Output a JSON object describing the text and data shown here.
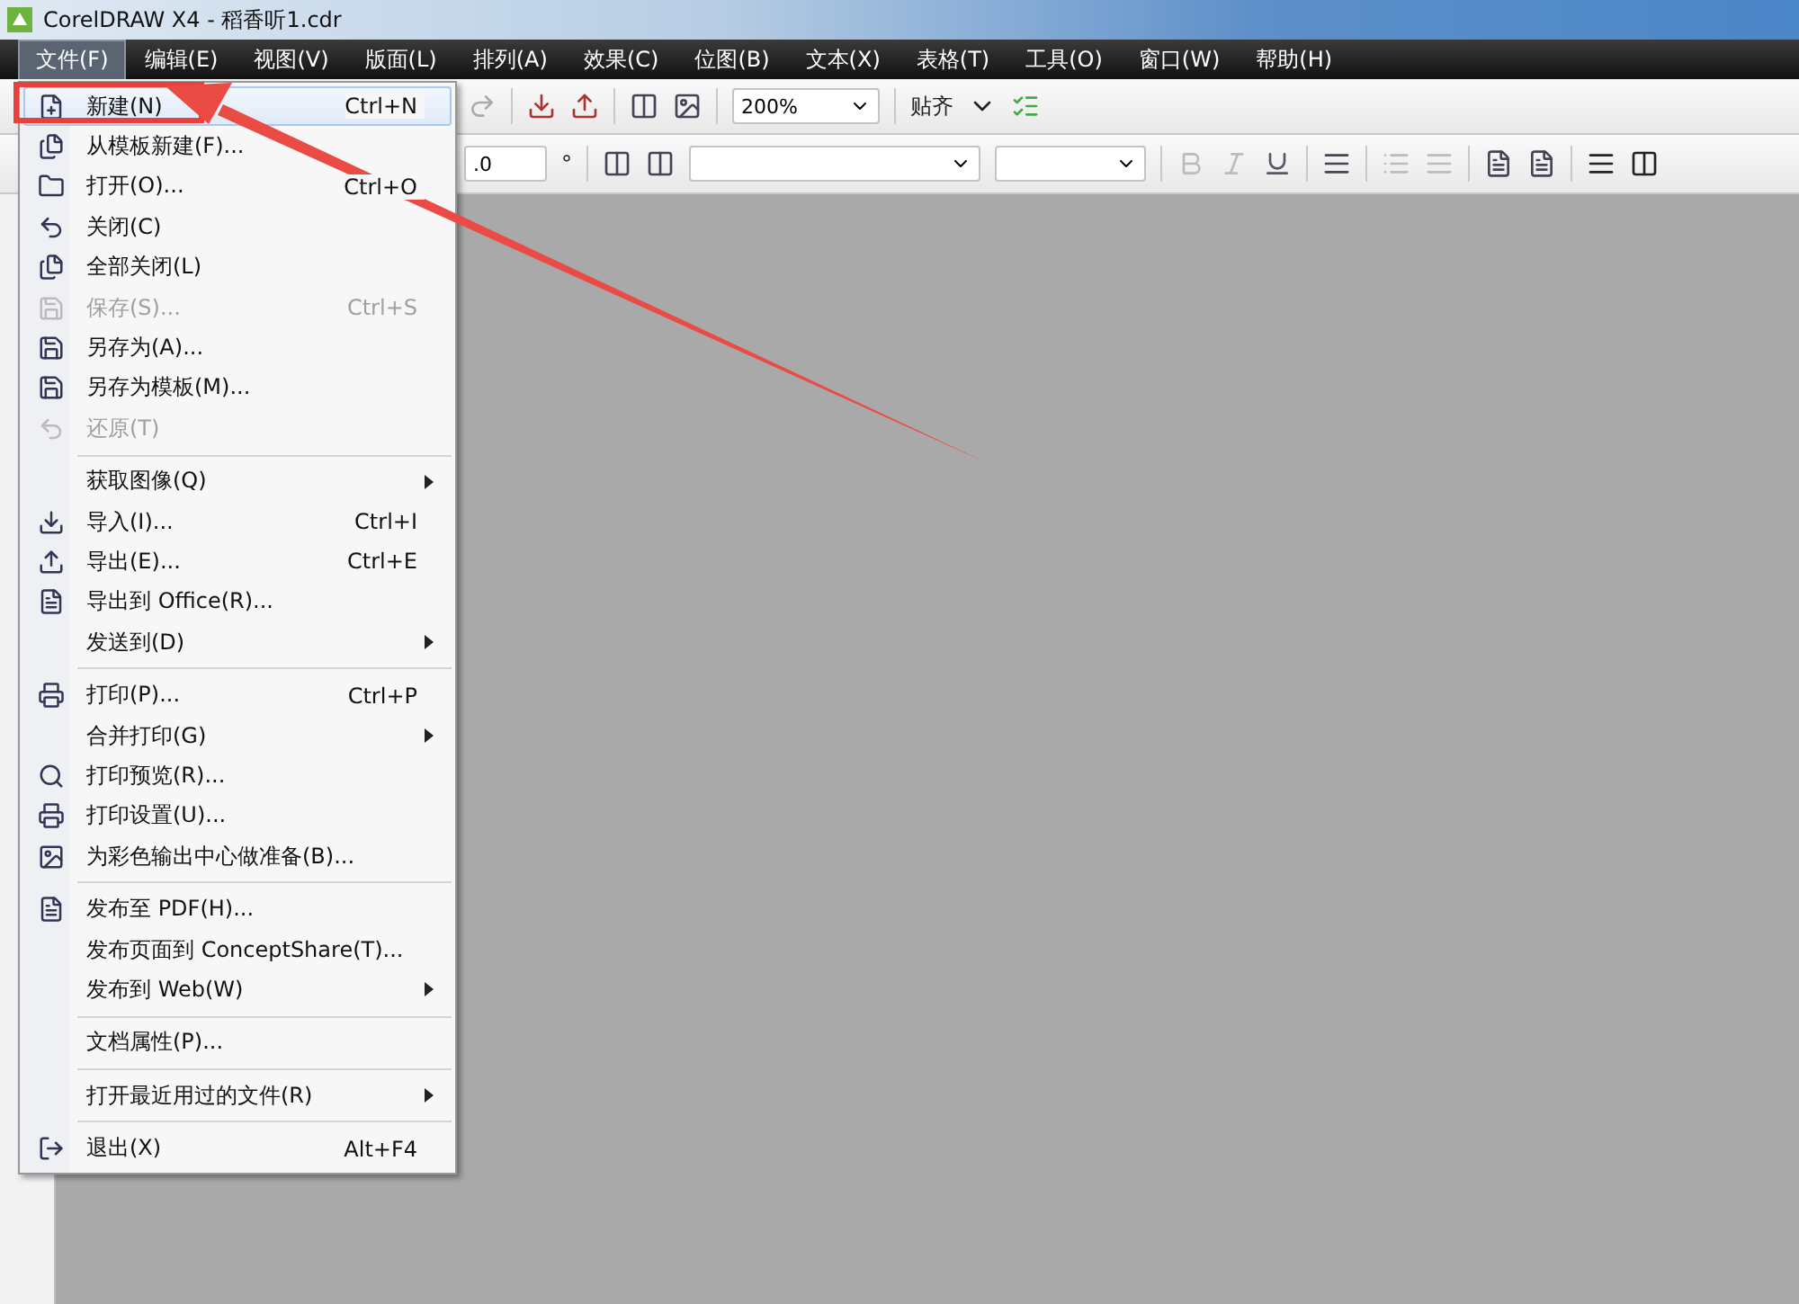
{
  "window": {
    "title": "CorelDRAW X4 - 稻香听1.cdr"
  },
  "menu_bar": [
    {
      "label": "文件(F)",
      "selected": true
    },
    {
      "label": "编辑(E)",
      "selected": false
    },
    {
      "label": "视图(V)",
      "selected": false
    },
    {
      "label": "版面(L)",
      "selected": false
    },
    {
      "label": "排列(A)",
      "selected": false
    },
    {
      "label": "效果(C)",
      "selected": false
    },
    {
      "label": "位图(B)",
      "selected": false
    },
    {
      "label": "文本(X)",
      "selected": false
    },
    {
      "label": "表格(T)",
      "selected": false
    },
    {
      "label": "工具(O)",
      "selected": false
    },
    {
      "label": "窗口(W)",
      "selected": false
    },
    {
      "label": "帮助(H)",
      "selected": false
    }
  ],
  "toolbar": {
    "zoom": "200%",
    "snap": "贴齐"
  },
  "property_bar": {
    "angle_value": ".0",
    "degree_sign": "°"
  },
  "file_menu": {
    "groups": [
      [
        {
          "label": "新建(N)",
          "shortcut": "Ctrl+N",
          "disabled": false,
          "submenu": false,
          "selected": true
        },
        {
          "label": "从模板新建(F)...",
          "disabled": false,
          "submenu": false,
          "selected": false
        },
        {
          "label": "打开(O)...",
          "shortcut": "Ctrl+O",
          "disabled": false,
          "submenu": false,
          "selected": false
        },
        {
          "label": "关闭(C)",
          "disabled": false,
          "submenu": false,
          "selected": false
        },
        {
          "label": "全部关闭(L)",
          "disabled": false,
          "submenu": false,
          "selected": false
        },
        {
          "label": "保存(S)...",
          "shortcut": "Ctrl+S",
          "disabled": true,
          "submenu": false,
          "selected": false
        },
        {
          "label": "另存为(A)...",
          "disabled": false,
          "submenu": false,
          "selected": false
        },
        {
          "label": "另存为模板(M)...",
          "disabled": false,
          "submenu": false,
          "selected": false
        },
        {
          "label": "还原(T)",
          "disabled": true,
          "submenu": false,
          "selected": false
        }
      ],
      [
        {
          "label": "获取图像(Q)",
          "disabled": false,
          "submenu": true,
          "selected": false
        },
        {
          "label": "导入(I)...",
          "shortcut": "Ctrl+I",
          "disabled": false,
          "submenu": false,
          "selected": false
        },
        {
          "label": "导出(E)...",
          "shortcut": "Ctrl+E",
          "disabled": false,
          "submenu": false,
          "selected": false
        },
        {
          "label": "导出到 Office(R)...",
          "disabled": false,
          "submenu": false,
          "selected": false
        },
        {
          "label": "发送到(D)",
          "disabled": false,
          "submenu": true,
          "selected": false
        }
      ],
      [
        {
          "label": "打印(P)...",
          "shortcut": "Ctrl+P",
          "disabled": false,
          "submenu": false,
          "selected": false
        },
        {
          "label": "合并打印(G)",
          "disabled": false,
          "submenu": true,
          "selected": false
        },
        {
          "label": "打印预览(R)...",
          "disabled": false,
          "submenu": false,
          "selected": false
        },
        {
          "label": "打印设置(U)...",
          "disabled": false,
          "submenu": false,
          "selected": false
        },
        {
          "label": "为彩色输出中心做准备(B)...",
          "disabled": false,
          "submenu": false,
          "selected": false
        }
      ],
      [
        {
          "label": "发布至 PDF(H)...",
          "disabled": false,
          "submenu": false,
          "selected": false
        },
        {
          "label": "发布页面到 ConceptShare(T)...",
          "disabled": false,
          "submenu": false,
          "selected": false
        },
        {
          "label": "发布到 Web(W)",
          "disabled": false,
          "submenu": true,
          "selected": false
        }
      ],
      [
        {
          "label": "文档属性(P)...",
          "disabled": false,
          "submenu": false,
          "selected": false
        }
      ],
      [
        {
          "label": "打开最近用过的文件(R)",
          "disabled": false,
          "submenu": true,
          "selected": false
        }
      ],
      [
        {
          "label": "退出(X)",
          "shortcut": "Alt+F4",
          "disabled": false,
          "submenu": false,
          "selected": false
        }
      ]
    ]
  }
}
